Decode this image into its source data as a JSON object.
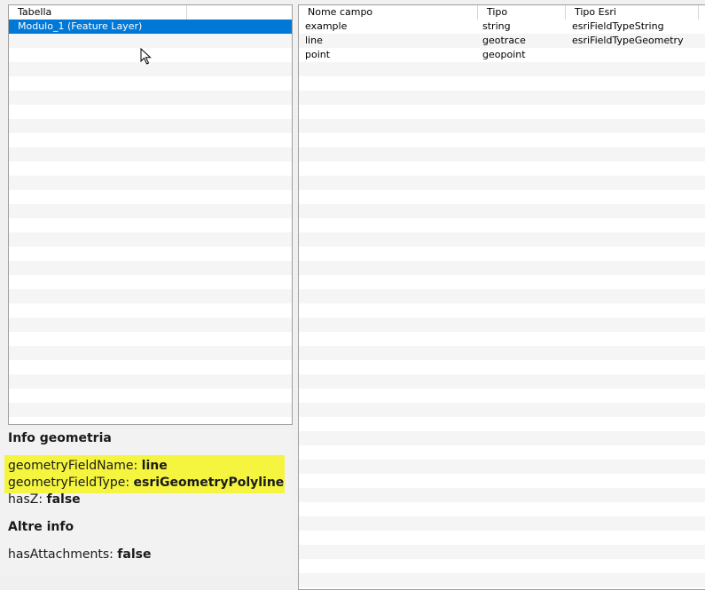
{
  "left_table": {
    "header": "Tabella",
    "rows": [
      {
        "name": "Modulo_1 (Feature Layer)"
      }
    ]
  },
  "right_table": {
    "headers": [
      "Nome campo",
      "Tipo",
      "Tipo Esri"
    ],
    "rows": [
      {
        "name": "example",
        "type": "string",
        "esri_type": "esriFieldTypeString"
      },
      {
        "name": "line",
        "type": "geotrace",
        "esri_type": "esriFieldTypeGeometry"
      },
      {
        "name": "point",
        "type": "geopoint",
        "esri_type": ""
      }
    ]
  },
  "info": {
    "geometry_heading": "Info geometria",
    "geometry_field_name_label": "geometryFieldName:",
    "geometry_field_name_value": "line",
    "geometry_field_type_label": "geometryFieldType:",
    "geometry_field_type_value": "esriGeometryPolyline",
    "has_z_label": "hasZ:",
    "has_z_value": "false",
    "other_heading": "Altre info",
    "has_attachments_label": "hasAttachments:",
    "has_attachments_value": "false"
  },
  "colors": {
    "selection": "#0078d7",
    "highlight": "#f5f540"
  },
  "icons": {
    "cursor": "mouse-pointer-icon"
  }
}
